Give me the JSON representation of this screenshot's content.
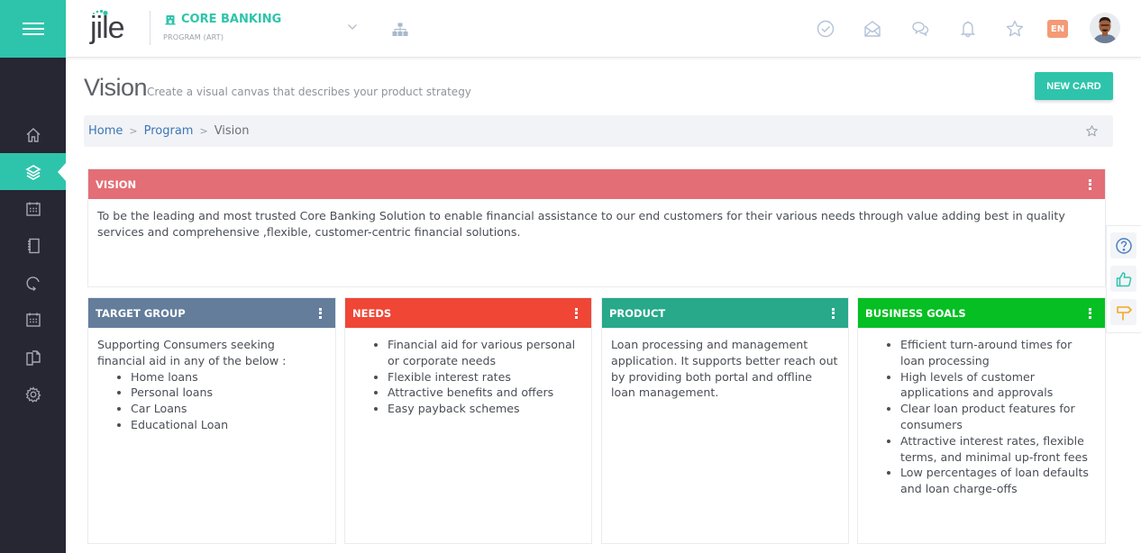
{
  "app": {
    "logo_text": "jile",
    "program_name": "CORE BANKING",
    "program_type": "PROGRAM (ART)",
    "language": "EN"
  },
  "header_icons": [
    "check-circle-icon",
    "open-mail-icon",
    "chat-icon",
    "bell-icon",
    "star-icon"
  ],
  "sidebar": {
    "items": [
      {
        "name": "home",
        "icon": "home-icon",
        "active": false
      },
      {
        "name": "layers",
        "icon": "layers-icon",
        "active": true
      },
      {
        "name": "calendar",
        "icon": "calendar-icon",
        "active": false
      },
      {
        "name": "notebook",
        "icon": "notebook-icon",
        "active": false
      },
      {
        "name": "refresh",
        "icon": "refresh-icon",
        "active": false
      },
      {
        "name": "calendar-2",
        "icon": "calendar-icon",
        "active": false
      },
      {
        "name": "documents",
        "icon": "copy-icon",
        "active": false
      },
      {
        "name": "settings",
        "icon": "gear-icon",
        "active": false
      }
    ]
  },
  "page": {
    "title": "Vision",
    "subtitle": "Create a visual canvas that describes your product strategy",
    "new_card_label": "NEW CARD"
  },
  "breadcrumb": {
    "items": [
      "Home",
      "Program"
    ],
    "current": "Vision",
    "separator": ">"
  },
  "colors": {
    "accent": "#2ec4ab",
    "vision": "#e36e76",
    "target_group": "#637d9b",
    "needs": "#ef4636",
    "product": "#27a98a",
    "business_goals": "#06bf23"
  },
  "cards": {
    "vision": {
      "title": "VISION",
      "text": "To be the leading and most trusted Core Banking Solution to enable financial assistance to our end customers for their various needs through value adding best in quality services and comprehensive ,flexible, customer-centric financial solutions."
    },
    "target_group": {
      "title": "TARGET GROUP",
      "intro": "Supporting Consumers seeking financial aid in any of the below :",
      "items": [
        "Home loans",
        "Personal loans",
        "Car Loans",
        "Educational Loan"
      ]
    },
    "needs": {
      "title": "NEEDS",
      "items": [
        "Financial aid for various personal or corporate needs",
        "Flexible interest rates",
        "Attractive benefits and offers",
        "Easy payback schemes"
      ]
    },
    "product": {
      "title": "PRODUCT",
      "text": "Loan processing and management application. It supports better reach out by providing both portal and offline loan management."
    },
    "business_goals": {
      "title": "BUSINESS GOALS",
      "items": [
        "Efficient turn-around times for loan processing",
        "High levels of customer applications and approvals",
        "Clear loan product features for consumers",
        "Attractive interest rates, flexible terms, and minimal up-front fees",
        "Low percentages of loan defaults and loan charge-offs"
      ]
    }
  },
  "float_panel": [
    "help-icon",
    "thumbs-up-icon",
    "signpost-icon"
  ]
}
